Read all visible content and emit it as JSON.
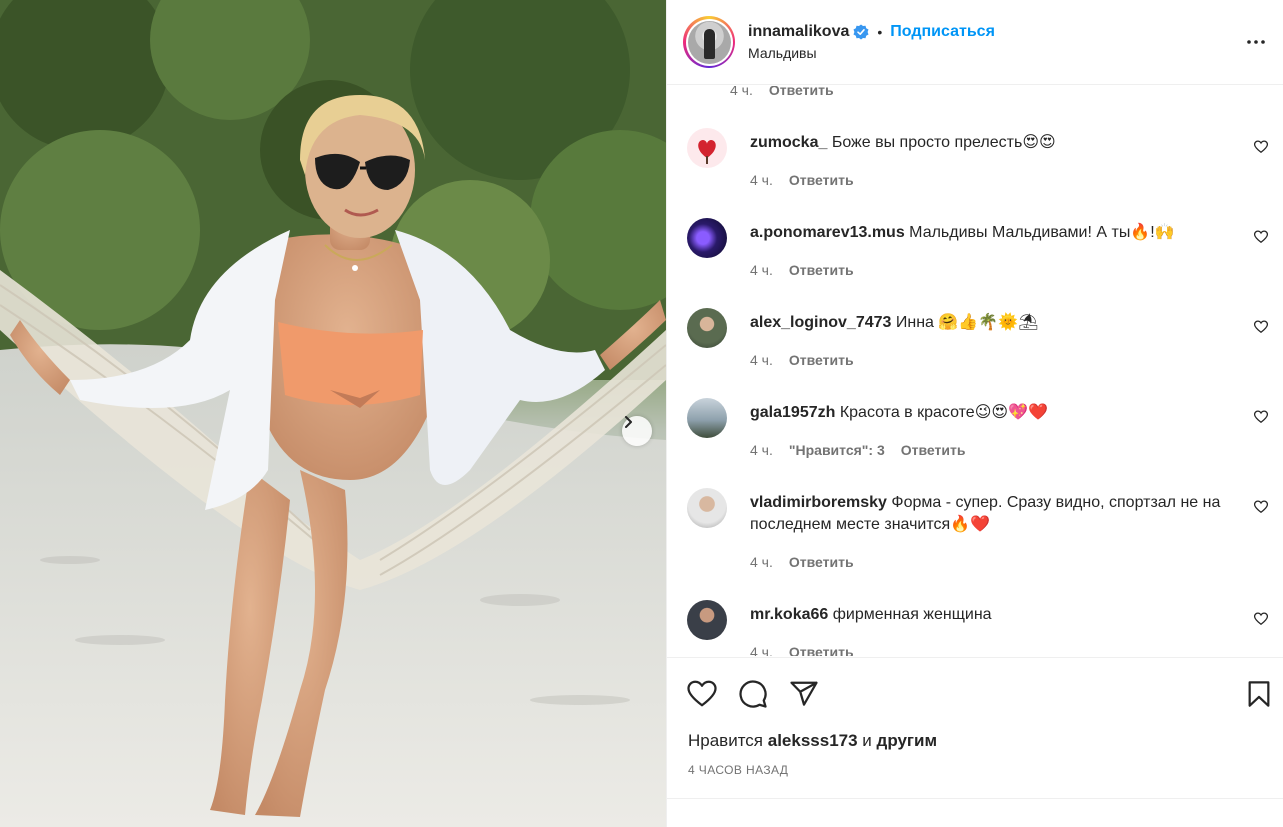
{
  "post": {
    "author": "innamalikova",
    "follow_label": "Подписаться",
    "separator": "•",
    "location": "Мальдивы"
  },
  "colors": {
    "link_blue": "#0095f6",
    "verified_blue": "#3897f0",
    "meta_gray": "#737373",
    "border": "#efefef"
  },
  "top_partial": {
    "time": "4 ч.",
    "reply_label": "Ответить"
  },
  "comments": [
    {
      "user": "zumocka_",
      "text": " Боже вы просто прелесть😍😍",
      "time": "4 ч.",
      "likes": "",
      "reply_label": "Ответить"
    },
    {
      "user": "a.ponomarev13.mus",
      "text": " Мальдивы Мальдивами! А ты🔥!🙌",
      "time": "4 ч.",
      "likes": "",
      "reply_label": "Ответить"
    },
    {
      "user": "alex_loginov_7473",
      "text": " Инна 🤗👍🌴🌞⛱",
      "time": "4 ч.",
      "likes": "",
      "reply_label": "Ответить"
    },
    {
      "user": "gala1957zh",
      "text": " Красота в красоте😉😍💖❤️",
      "time": "4 ч.",
      "likes": "\"Нравится\": 3",
      "reply_label": "Ответить"
    },
    {
      "user": "vladimirboremsky",
      "text": " Форма - супер. Сразу видно, спортзал не на последнем месте значится🔥❤️",
      "time": "4 ч.",
      "likes": "",
      "reply_label": "Ответить"
    },
    {
      "user": "mr.koka66",
      "text": " фирменная женщина",
      "time": "4 ч.",
      "likes": "",
      "reply_label": "Ответить"
    }
  ],
  "likes_line": {
    "prefix": "Нравится ",
    "user": "aleksss173",
    "middle": " и ",
    "others": "другим"
  },
  "time_ago": "4 ЧАСОВ НАЗАД",
  "icons": [
    "heart-icon",
    "comment-icon",
    "share-icon",
    "bookmark-icon",
    "more-icon",
    "verified-icon",
    "chevron-right-icon"
  ]
}
